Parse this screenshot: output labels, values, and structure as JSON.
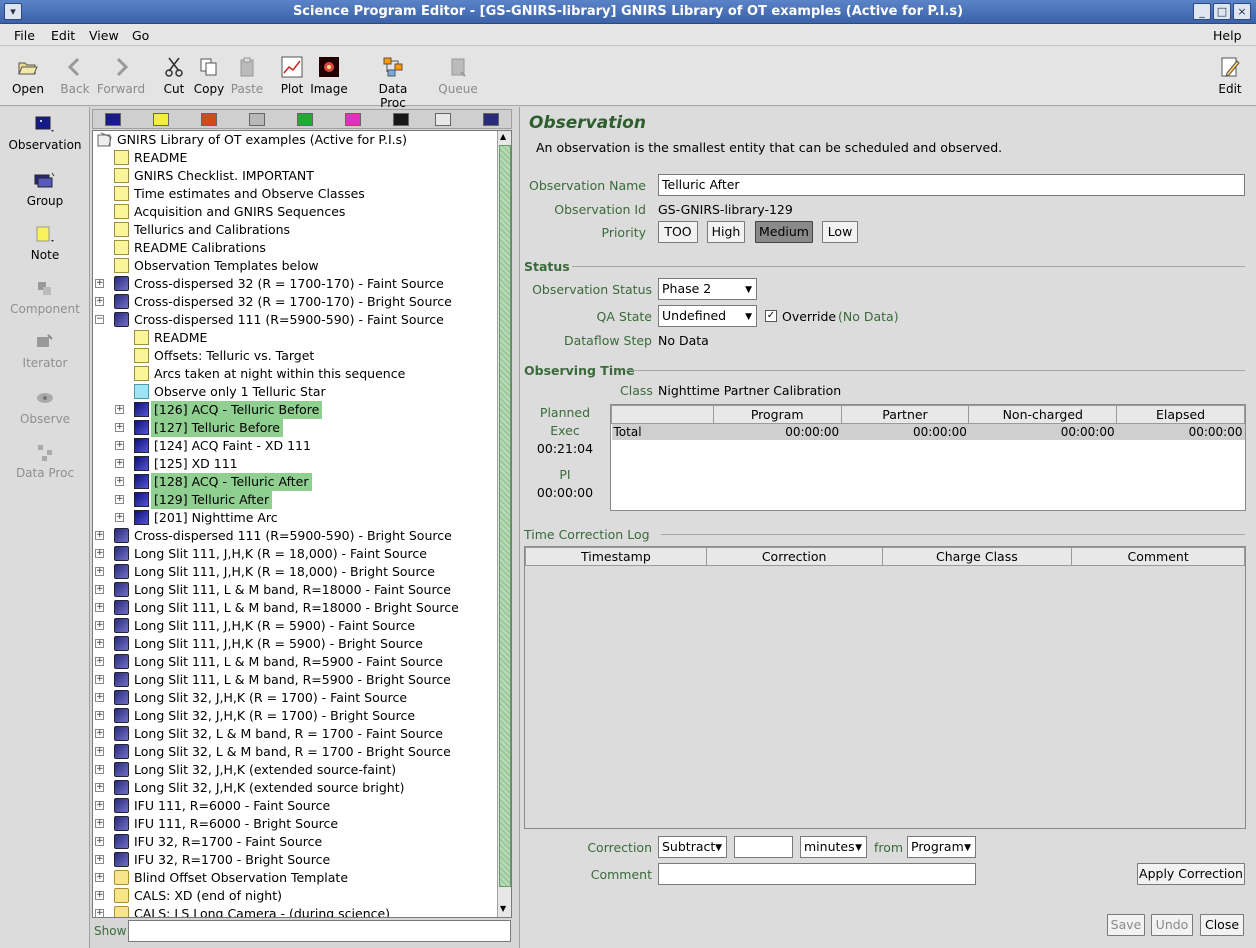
{
  "window": {
    "title": "Science Program Editor - [GS-GNIRS-library] GNIRS Library of OT examples (Active for P.I.s)"
  },
  "menu": {
    "file": "File",
    "edit": "Edit",
    "view": "View",
    "go": "Go",
    "help": "Help"
  },
  "toolbar": {
    "open": "Open",
    "back": "Back",
    "forward": "Forward",
    "cut": "Cut",
    "copy": "Copy",
    "paste": "Paste",
    "plot": "Plot",
    "image": "Image",
    "dataproc": "Data Proc",
    "queue": "Queue",
    "edit": "Edit"
  },
  "leftbar": {
    "observation": "Observation",
    "group": "Group",
    "note": "Note",
    "component": "Component",
    "iterator": "Iterator",
    "observe": "Observe",
    "dataproc": "Data Proc"
  },
  "tree": {
    "root": "GNIRS Library of OT examples (Active for P.I.s)",
    "items": [
      {
        "label": "README",
        "level": 1,
        "type": "note",
        "exp": ""
      },
      {
        "label": "GNIRS Checklist.  IMPORTANT",
        "level": 1,
        "type": "note",
        "exp": ""
      },
      {
        "label": "Time estimates and Observe Classes",
        "level": 1,
        "type": "note",
        "exp": ""
      },
      {
        "label": "Acquisition and GNIRS Sequences",
        "level": 1,
        "type": "note",
        "exp": ""
      },
      {
        "label": "Tellurics and Calibrations",
        "level": 1,
        "type": "note",
        "exp": ""
      },
      {
        "label": "README Calibrations",
        "level": 1,
        "type": "note",
        "exp": ""
      },
      {
        "label": "Observation Templates below",
        "level": 1,
        "type": "note",
        "exp": ""
      },
      {
        "label": "Cross-dispersed 32 (R = 1700-170) - Faint Source",
        "level": 1,
        "type": "grp",
        "exp": "+"
      },
      {
        "label": "Cross-dispersed 32 (R = 1700-170) - Bright Source",
        "level": 1,
        "type": "grp",
        "exp": "+"
      },
      {
        "label": "Cross-dispersed 111 (R=5900-590) - Faint Source",
        "level": 1,
        "type": "grp",
        "exp": "-"
      },
      {
        "label": "README",
        "level": 2,
        "type": "note",
        "exp": ""
      },
      {
        "label": "Offsets: Telluric vs. Target",
        "level": 2,
        "type": "note",
        "exp": ""
      },
      {
        "label": "Arcs taken at night within this sequence",
        "level": 2,
        "type": "note",
        "exp": ""
      },
      {
        "label": "Observe only 1 Telluric Star",
        "level": 2,
        "type": "notecyan",
        "exp": ""
      },
      {
        "label": "[126] ACQ - Telluric Before",
        "level": 2,
        "type": "obs",
        "exp": "+",
        "sel": true
      },
      {
        "label": "[127] Telluric Before",
        "level": 2,
        "type": "obs",
        "exp": "+",
        "sel": true
      },
      {
        "label": "[124] ACQ Faint - XD 111",
        "level": 2,
        "type": "obs",
        "exp": "+"
      },
      {
        "label": "[125] XD 111",
        "level": 2,
        "type": "obs",
        "exp": "+"
      },
      {
        "label": "[128] ACQ - Telluric After",
        "level": 2,
        "type": "obs",
        "exp": "+",
        "sel": true
      },
      {
        "label": "[129] Telluric After",
        "level": 2,
        "type": "obs",
        "exp": "+",
        "sel": true
      },
      {
        "label": "[201] Nighttime Arc",
        "level": 2,
        "type": "obs",
        "exp": "+"
      },
      {
        "label": "Cross-dispersed 111 (R=5900-590) - Bright Source",
        "level": 1,
        "type": "grp",
        "exp": "+"
      },
      {
        "label": "Long Slit 111,  J,H,K (R = 18,000) - Faint Source",
        "level": 1,
        "type": "grp",
        "exp": "+"
      },
      {
        "label": "Long Slit 111,  J,H,K (R = 18,000) - Bright Source",
        "level": 1,
        "type": "grp",
        "exp": "+"
      },
      {
        "label": "Long Slit 111,  L & M band, R=18000 - Faint Source",
        "level": 1,
        "type": "grp",
        "exp": "+"
      },
      {
        "label": "Long Slit 111,  L & M band, R=18000 - Bright Source",
        "level": 1,
        "type": "grp",
        "exp": "+"
      },
      {
        "label": "Long Slit 111,  J,H,K (R = 5900) - Faint Source",
        "level": 1,
        "type": "grp",
        "exp": "+"
      },
      {
        "label": "Long Slit 111,  J,H,K (R = 5900) - Bright Source",
        "level": 1,
        "type": "grp",
        "exp": "+"
      },
      {
        "label": "Long Slit 111,  L & M band, R=5900 - Faint Source",
        "level": 1,
        "type": "grp",
        "exp": "+"
      },
      {
        "label": "Long Slit 111,  L & M band, R=5900 - Bright Source",
        "level": 1,
        "type": "grp",
        "exp": "+"
      },
      {
        "label": "Long Slit 32,  J,H,K (R = 1700) - Faint Source",
        "level": 1,
        "type": "grp",
        "exp": "+"
      },
      {
        "label": "Long Slit 32,  J,H,K (R = 1700) - Bright Source",
        "level": 1,
        "type": "grp",
        "exp": "+"
      },
      {
        "label": "Long Slit 32,  L & M band, R = 1700 - Faint Source",
        "level": 1,
        "type": "grp",
        "exp": "+"
      },
      {
        "label": "Long Slit 32,  L & M band, R = 1700 - Bright Source",
        "level": 1,
        "type": "grp",
        "exp": "+"
      },
      {
        "label": "Long Slit 32, J,H,K (extended source-faint)",
        "level": 1,
        "type": "grp",
        "exp": "+"
      },
      {
        "label": "Long Slit 32, J,H,K (extended source bright)",
        "level": 1,
        "type": "grp",
        "exp": "+"
      },
      {
        "label": "IFU 111, R=6000 - Faint Source",
        "level": 1,
        "type": "grp",
        "exp": "+"
      },
      {
        "label": "IFU 111, R=6000 - Bright Source",
        "level": 1,
        "type": "grp",
        "exp": "+"
      },
      {
        "label": "IFU 32, R=1700 - Faint Source",
        "level": 1,
        "type": "grp",
        "exp": "+"
      },
      {
        "label": "IFU 32, R=1700 - Bright Source",
        "level": 1,
        "type": "grp",
        "exp": "+"
      },
      {
        "label": "Blind Offset Observation Template",
        "level": 1,
        "type": "fold",
        "exp": "+"
      },
      {
        "label": "CALS: XD (end of night)",
        "level": 1,
        "type": "fold",
        "exp": "+"
      },
      {
        "label": "CALS: LS Long Camera - (during science)",
        "level": 1,
        "type": "fold",
        "exp": "+"
      }
    ]
  },
  "show": {
    "label": "Show",
    "value": ""
  },
  "obs": {
    "heading": "Observation",
    "description": "An observation is the smallest entity that can be scheduled and observed.",
    "name_label": "Observation Name",
    "name_value": "Telluric After",
    "id_label": "Observation Id",
    "id_value": "GS-GNIRS-library-129",
    "priority_label": "Priority",
    "priority": {
      "too": "TOO",
      "high": "High",
      "medium": "Medium",
      "low": "Low"
    }
  },
  "status": {
    "heading": "Status",
    "obs_status_label": "Observation Status",
    "obs_status_value": "Phase 2",
    "qa_label": "QA State",
    "qa_value": "Undefined",
    "override_label": "Override",
    "no_data_paren": "(No Data)",
    "dataflow_label": "Dataflow Step",
    "dataflow_value": "No Data"
  },
  "time": {
    "heading": "Observing Time",
    "class_label": "Class",
    "class_value": "Nighttime Partner Calibration",
    "planned_label": "Planned",
    "exec_label": "Exec",
    "exec_value": "00:21:04",
    "pi_label": "PI",
    "pi_value": "00:00:00",
    "table_headers": [
      "",
      "Program",
      "Partner",
      "Non-charged",
      "Elapsed"
    ],
    "total_row": [
      "Total",
      "00:00:00",
      "00:00:00",
      "00:00:00",
      "00:00:00"
    ]
  },
  "log": {
    "heading": "Time Correction Log",
    "headers": [
      "Timestamp",
      "Correction",
      "Charge Class",
      "Comment"
    ]
  },
  "correction": {
    "label": "Correction",
    "op": "Subtract",
    "amount": "",
    "unit": "minutes",
    "from_label": "from",
    "from_value": "Program",
    "comment_label": "Comment",
    "comment_value": "",
    "apply": "Apply Correction"
  },
  "footer": {
    "save": "Save",
    "undo": "Undo",
    "close": "Close"
  },
  "colors": {
    "accent_green": "#3a6a3a",
    "selection_green": "#8fcf8f",
    "title_blue": "#3b62a8"
  }
}
